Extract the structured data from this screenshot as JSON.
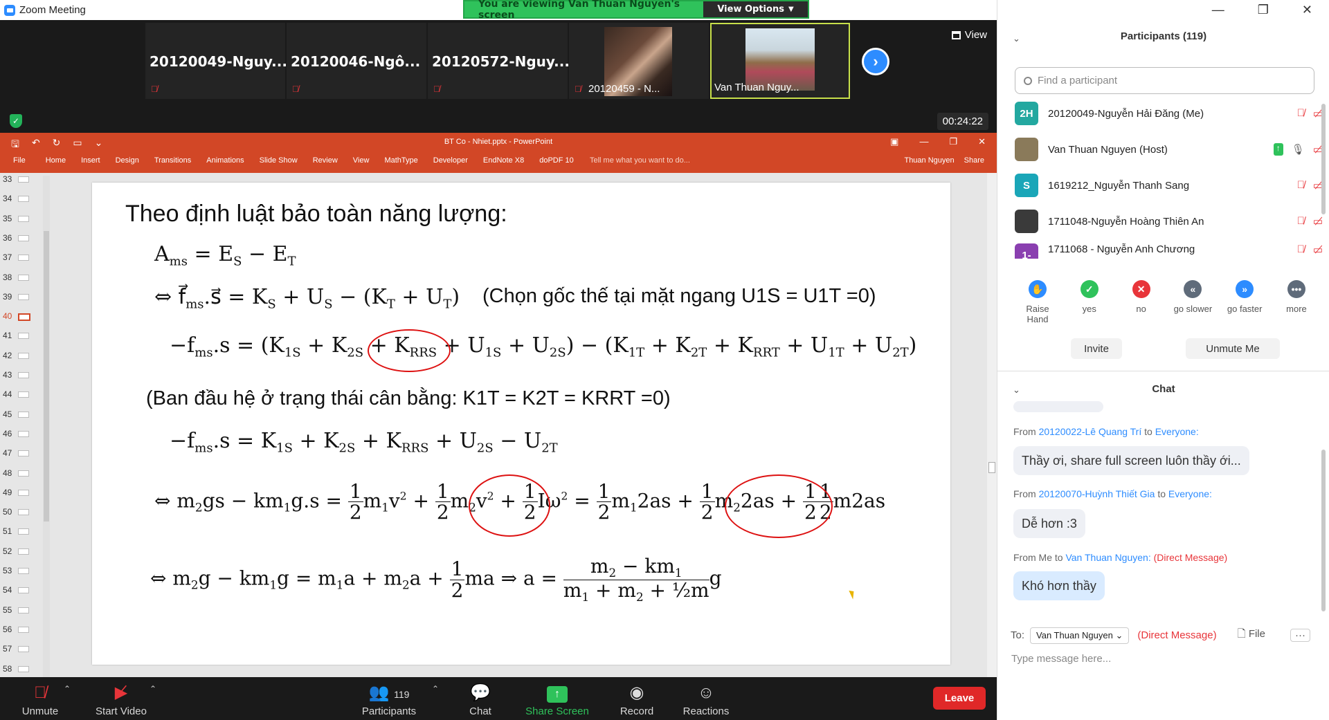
{
  "window": {
    "app_title": "Zoom Meeting"
  },
  "banner": {
    "message": "You are viewing Van Thuan Nguyen's screen",
    "view_options": "View Options"
  },
  "strip": {
    "tiles": [
      {
        "name": "20120049-Nguy..."
      },
      {
        "name": "20120046-Ngô..."
      },
      {
        "name": "20120572-Nguy..."
      },
      {
        "name": "20120459 - N..."
      },
      {
        "name": "Van Thuan Nguy..."
      }
    ],
    "view_label": "View",
    "timer": "00:24:22"
  },
  "ppt": {
    "title": "BT Co - Nhiet.pptx - PowerPoint",
    "menu": [
      "File",
      "Home",
      "Insert",
      "Design",
      "Transitions",
      "Animations",
      "Slide Show",
      "Review",
      "View",
      "MathType",
      "Developer",
      "EndNote X8",
      "doPDF 10"
    ],
    "tell_me": "Tell me what you want to do...",
    "user": "Thuan Nguyen",
    "share": "Share",
    "slide_numbers": [
      "33",
      "34",
      "35",
      "36",
      "37",
      "38",
      "39",
      "40",
      "41",
      "42",
      "43",
      "44",
      "45",
      "46",
      "47",
      "48",
      "49",
      "50",
      "51",
      "52",
      "53",
      "54",
      "55",
      "56",
      "57",
      "58"
    ],
    "active_slide": "40",
    "slide": {
      "heading": "Theo định luật bảo toàn năng lượng:",
      "note1": "(Chọn gốc thế tại mặt ngang U1S = U1T =0)",
      "note2": "(Ban đầu hệ ở trạng thái cân bằng: K1T = K2T = KRRT =0)"
    }
  },
  "toolbar": {
    "unmute": "Unmute",
    "start_video": "Start Video",
    "participants": "Participants",
    "participants_count": "119",
    "chat": "Chat",
    "share_screen": "Share Screen",
    "record": "Record",
    "reactions": "Reactions",
    "leave": "Leave"
  },
  "panel": {
    "participants_header": "Participants (119)",
    "search_placeholder": "Find a participant",
    "participants": [
      {
        "initials": "2H",
        "name": "20120049-Nguyễn Hải Đăng (Me)",
        "color": "#23a8a0"
      },
      {
        "initials": "",
        "name": "Van Thuan Nguyen (Host)",
        "color": "#8a7a5a"
      },
      {
        "initials": "S",
        "name": "1619212_Nguyễn Thanh Sang",
        "color": "#1aa6b8"
      },
      {
        "initials": "",
        "name": "1711048-Nguyễn Hoàng Thiên An",
        "color": "#3a3a3a"
      },
      {
        "initials": "1-",
        "name": "1711068 - Nguyễn Anh Chương",
        "color": "#8a3fb0"
      }
    ],
    "reactions": [
      {
        "label": "Raise Hand",
        "color": "#2d8cff",
        "glyph": "✋"
      },
      {
        "label": "yes",
        "color": "#2fc25b",
        "glyph": "✓"
      },
      {
        "label": "no",
        "color": "#e8353a",
        "glyph": "✕"
      },
      {
        "label": "go slower",
        "color": "#5f6b7a",
        "glyph": "«"
      },
      {
        "label": "go faster",
        "color": "#2d8cff",
        "glyph": "»"
      },
      {
        "label": "more",
        "color": "#5f6b7a",
        "glyph": "•••"
      }
    ],
    "invite": "Invite",
    "unmute_me": "Unmute Me",
    "chat_header": "Chat",
    "messages": [
      {
        "from_prefix": "From",
        "sender": "20120022-Lê Quang Trí",
        "to_word": "to",
        "recipient": "Everyone:",
        "text": "Thầy ơi, share full screen luôn thầy ới..."
      },
      {
        "from_prefix": "From",
        "sender": "20120070-Huỳnh Thiết Gia",
        "to_word": "to",
        "recipient": "Everyone:",
        "text": "Dễ hơn :3"
      },
      {
        "from_prefix": "From Me to",
        "sender": "Van Thuan Nguyen:",
        "dm": "(Direct Message)",
        "text": "Khó hơn thầy"
      }
    ],
    "to_label": "To:",
    "to_value": "Van Thuan Nguyen",
    "direct_message": "(Direct Message)",
    "file_label": "File",
    "type_placeholder": "Type message here..."
  }
}
